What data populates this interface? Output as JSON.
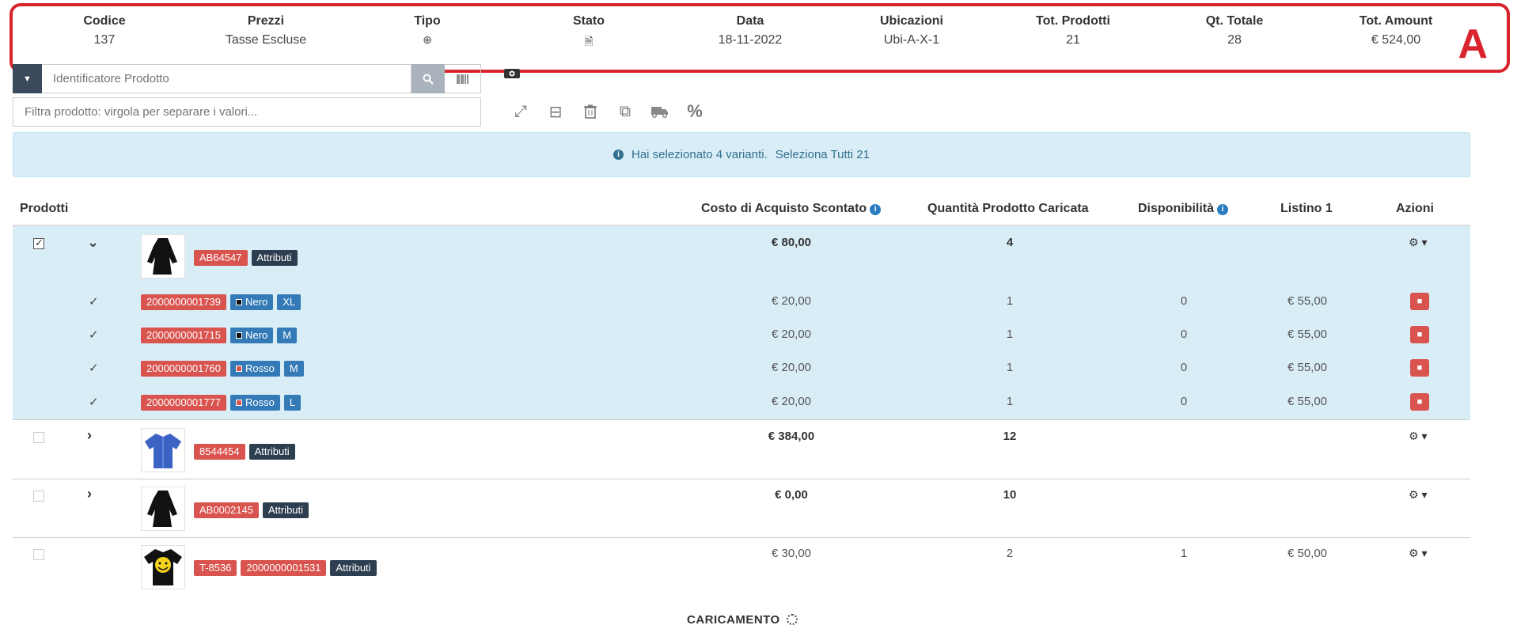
{
  "summary": {
    "codice": {
      "label": "Codice",
      "value": "137"
    },
    "prezzi": {
      "label": "Prezzi",
      "value": "Tasse Escluse"
    },
    "tipo": {
      "label": "Tipo",
      "value": "⊕"
    },
    "stato": {
      "label": "Stato",
      "value": "🗎"
    },
    "data": {
      "label": "Data",
      "value": "18-11-2022"
    },
    "ubicazioni": {
      "label": "Ubicazioni",
      "value": "Ubi-A-X-1"
    },
    "tot_prodotti": {
      "label": "Tot. Prodotti",
      "value": "21"
    },
    "qt_totale": {
      "label": "Qt. Totale",
      "value": "28"
    },
    "tot_amount": {
      "label": "Tot. Amount",
      "value": "€ 524,00"
    },
    "marker": "A",
    "marker_color": "#d9232d"
  },
  "search": {
    "placeholder": "Identificatore Prodotto"
  },
  "filter": {
    "placeholder": "Filtra prodotto: virgola per separare i valori..."
  },
  "alert": {
    "text": "Hai selezionato 4 varianti.",
    "select_all": "Seleziona Tutti 21"
  },
  "table": {
    "headers": {
      "prodotti": "Prodotti",
      "costo": "Costo di Acquisto Scontato",
      "quantita": "Quantità Prodotto Caricata",
      "disponibilita": "Disponibilità",
      "listino": "Listino 1",
      "azioni": "Azioni"
    },
    "rows": [
      {
        "ref": "AB64547",
        "attr": "Attributi",
        "cost": "€ 80,00",
        "qty": "4",
        "variants": [
          {
            "code": "2000000001739",
            "color": "Nero",
            "size": "XL",
            "cost": "€ 20,00",
            "qty": "1",
            "avail": "0",
            "price": "€ 55,00"
          },
          {
            "code": "2000000001715",
            "color": "Nero",
            "size": "M",
            "cost": "€ 20,00",
            "qty": "1",
            "avail": "0",
            "price": "€ 55,00"
          },
          {
            "code": "2000000001760",
            "color": "Rosso",
            "size": "M",
            "cost": "€ 20,00",
            "qty": "1",
            "avail": "0",
            "price": "€ 55,00"
          },
          {
            "code": "2000000001777",
            "color": "Rosso",
            "size": "L",
            "cost": "€ 20,00",
            "qty": "1",
            "avail": "0",
            "price": "€ 55,00"
          }
        ]
      },
      {
        "ref": "8544454",
        "attr": "Attributi",
        "cost": "€ 384,00",
        "qty": "12"
      },
      {
        "ref": "AB0002145",
        "attr": "Attributi",
        "cost": "€ 0,00",
        "qty": "10"
      },
      {
        "ref": "T-8536",
        "code": "2000000001531",
        "attr": "Attributi",
        "cost": "€ 30,00",
        "qty": "2",
        "avail": "1",
        "price": "€ 50,00"
      }
    ]
  },
  "loading": "CARICAMENTO",
  "colors": {
    "red_tag": "#d9534f",
    "dark_tag": "#2c3e50",
    "blue_tag": "#337ab7",
    "alert_bg": "#d9edf7"
  }
}
